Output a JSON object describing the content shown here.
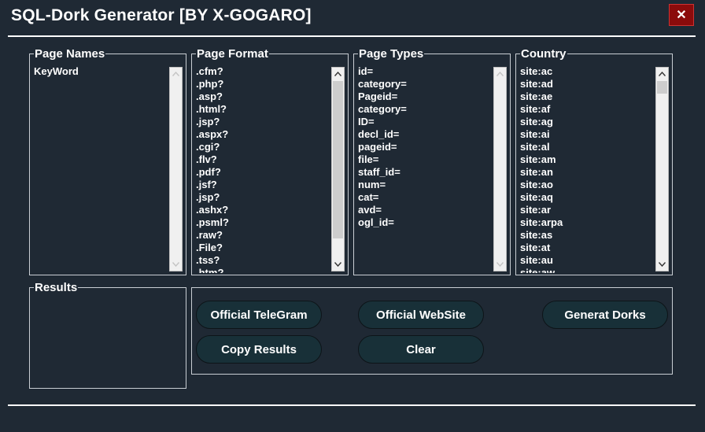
{
  "window": {
    "title": "SQL-Dork Generator [BY X-GOGARO]",
    "close_glyph": "✕"
  },
  "groups": {
    "page_names": {
      "label": "Page Names",
      "items": [
        "KeyWord"
      ]
    },
    "page_format": {
      "label": "Page Format",
      "items": [
        ".cfm?",
        ".php?",
        ".asp?",
        ".html?",
        ".jsp?",
        ".aspx?",
        ".cgi?",
        ".flv?",
        ".pdf?",
        ".jsf?",
        ".jsp?",
        ".ashx?",
        ".psml?",
        ".raw?",
        ".File?",
        ".tss?",
        ".htm?"
      ]
    },
    "page_types": {
      "label": "Page Types",
      "items": [
        "id=",
        "category=",
        "Pageid=",
        "category=",
        "ID=",
        "decl_id=",
        "pageid=",
        "file=",
        "staff_id=",
        "num=",
        "cat=",
        "avd=",
        "ogl_id="
      ]
    },
    "country": {
      "label": "Country",
      "items": [
        "site:ac",
        "site:ad",
        "site:ae",
        "site:af",
        "site:ag",
        "site:ai",
        "site:al",
        "site:am",
        "site:an",
        "site:ao",
        "site:aq",
        "site:ar",
        "site:arpa",
        "site:as",
        "site:at",
        "site:au",
        "site:aw"
      ]
    },
    "results": {
      "label": "Results"
    }
  },
  "buttons": {
    "telegram": "Official TeleGram",
    "website": "Official WebSite",
    "generate": "Generat Dorks",
    "copy": "Copy Results",
    "clear": "Clear"
  },
  "colors": {
    "background": "#1f2934",
    "button": "#183038",
    "close": "#8b0b0b"
  }
}
